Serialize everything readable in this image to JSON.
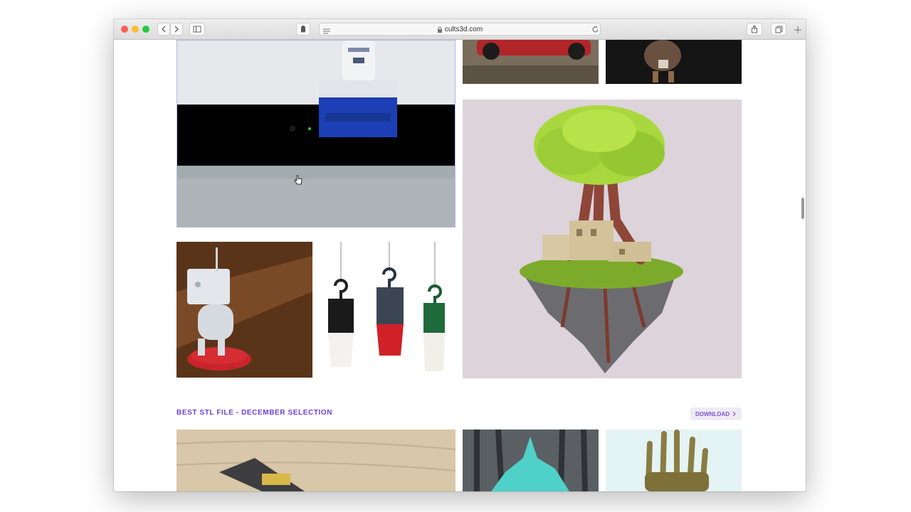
{
  "browser": {
    "url": "cults3d.com"
  },
  "icons": {
    "back": "chevron-left-icon",
    "forward": "chevron-right-icon",
    "sidebar": "sidebar-icon",
    "extension": "ghostery-icon",
    "reader": "reader-icon",
    "lock": "lock-icon",
    "reload": "reload-icon",
    "share": "share-icon",
    "tabs": "tabs-icon",
    "new_tab": "plus-icon",
    "cursor": "hand-pointer-icon",
    "arrow": "chevron-right-icon"
  },
  "colors": {
    "accent": "#6b3fd6",
    "button_bg": "#eeeaf5"
  },
  "section": {
    "title": "BEST STL FILE - DECEMBER SELECTION",
    "download_label": "DOWNLOAD"
  },
  "tiles": [
    "r2d2-printer-model",
    "rc-car-model",
    "figurine-model",
    "floating-island-tree-model",
    "tv-head-robot-model",
    "hanging-lanterns-model",
    "wood-printer-part-model",
    "teal-sculpture-model",
    "skeleton-hand-model"
  ]
}
